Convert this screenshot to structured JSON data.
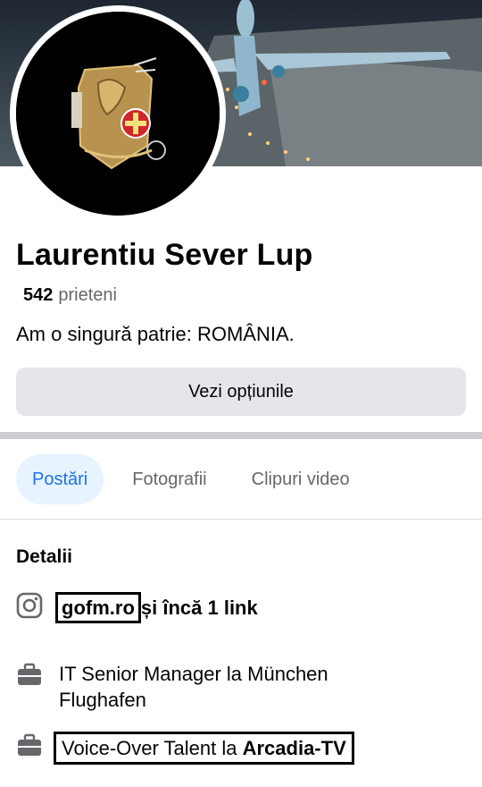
{
  "profile": {
    "name": "Laurentiu Sever Lup",
    "friends_count": "542",
    "friends_label": "prieteni",
    "bio": "Am o singură patrie: ROMÂNIA.",
    "options_button": "Vezi opțiunile"
  },
  "tabs": [
    {
      "label": "Postări",
      "active": true
    },
    {
      "label": "Fotografii",
      "active": false
    },
    {
      "label": "Clipuri video",
      "active": false
    }
  ],
  "details": {
    "title": "Detalii",
    "links": {
      "icon": "instagram-icon",
      "primary": "gofm.ro",
      "rest": "și încă 1 link"
    },
    "job1": {
      "icon": "briefcase-icon",
      "text": "IT Senior Manager la München Flughafen"
    },
    "job2": {
      "icon": "briefcase-icon",
      "prefix": "Voice-Over Talent la ",
      "company": "Arcadia-TV"
    }
  },
  "colors": {
    "accent": "#1b74e4",
    "accent_bg": "#e7f3ff",
    "button_bg": "#e4e6eb",
    "secondary_text": "#65676b"
  }
}
